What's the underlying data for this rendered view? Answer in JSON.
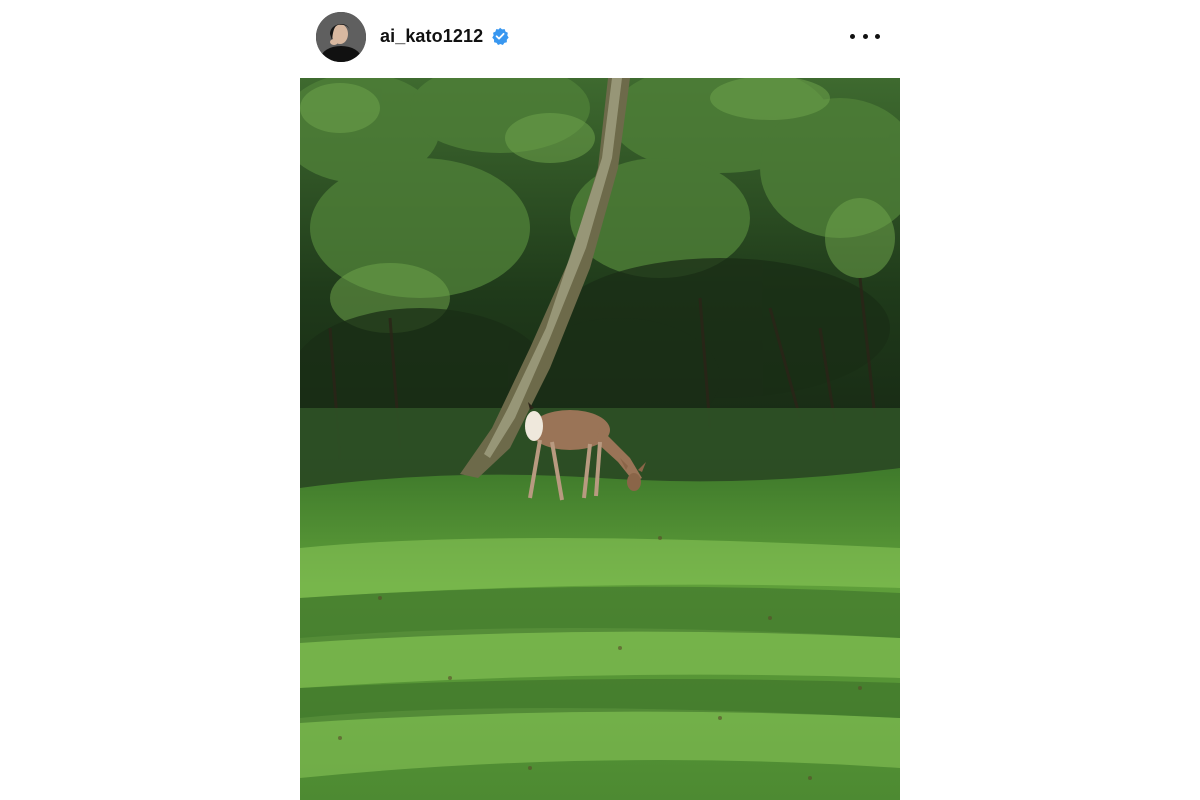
{
  "post": {
    "username": "ai_kato1212",
    "verified": true,
    "icons": {
      "avatar": "profile-photo",
      "verified": "verified-badge-icon",
      "more": "more-options-icon"
    },
    "colors": {
      "verified_badge": "#3897f0",
      "text": "#111111",
      "background": "#ffffff"
    },
    "photo": {
      "subject": "photo"
    }
  }
}
